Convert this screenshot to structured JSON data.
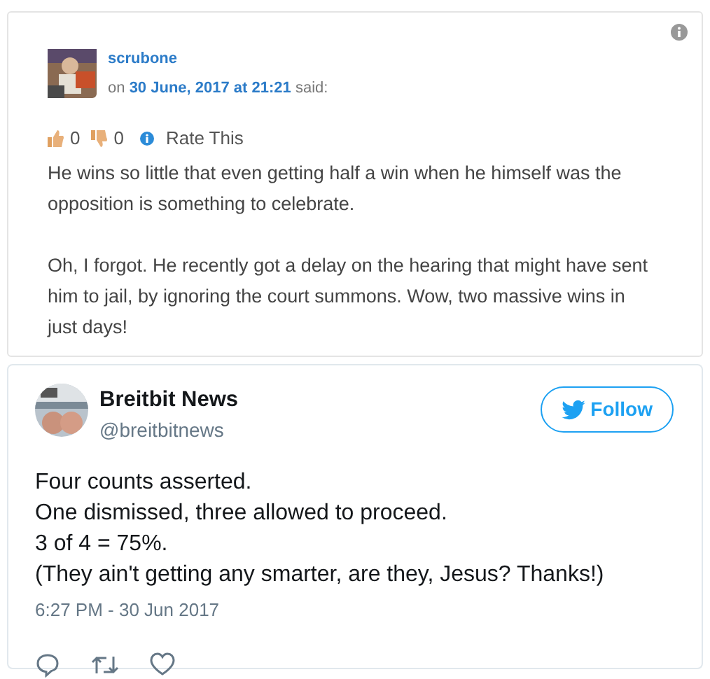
{
  "comment": {
    "author": "scrubone",
    "prefix": "on",
    "date": "30 June, 2017 at 21:21",
    "suffix": "said:",
    "likes": "0",
    "dislikes": "0",
    "rate_label": "Rate This",
    "paragraphs": [
      "He wins so little that even getting half a win when he himself was the opposition is something to celebrate.",
      "Oh, I forgot. He recently got a delay on the hearing that might have sent him to jail, by ignoring the court summons. Wow, two massive wins in just days!"
    ]
  },
  "tweet": {
    "name": "Breitbit News",
    "handle": "@breitbitnews",
    "follow_label": "Follow",
    "lines": [
      "Four counts asserted.",
      "One dismissed, three allowed to proceed.",
      "3 of 4 = 75%.",
      "(They ain't getting any smarter, are they, Jesus? Thanks!)"
    ],
    "time": "6:27 PM - 30 Jun 2017"
  }
}
